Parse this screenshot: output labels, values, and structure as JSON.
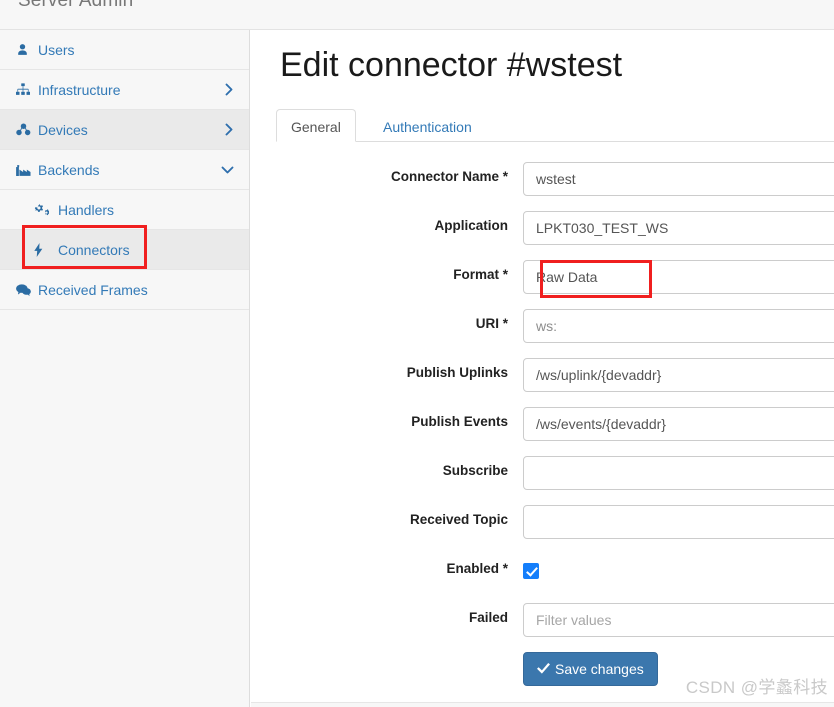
{
  "app": {
    "brand_title": "Server Admin"
  },
  "sidebar": {
    "items": [
      {
        "label": "Users",
        "icon": "user-icon",
        "chevron": "",
        "active": false,
        "sub": false
      },
      {
        "label": "Infrastructure",
        "icon": "sitemap-icon",
        "chevron": "chevron-right",
        "active": false,
        "sub": false
      },
      {
        "label": "Devices",
        "icon": "cubes-icon",
        "chevron": "chevron-right",
        "active": true,
        "sub": false
      },
      {
        "label": "Backends",
        "icon": "industry-icon",
        "chevron": "chevron-down",
        "active": false,
        "sub": false
      },
      {
        "label": "Handlers",
        "icon": "cogs-icon",
        "chevron": "",
        "active": false,
        "sub": true
      },
      {
        "label": "Connectors",
        "icon": "bolt-icon",
        "chevron": "",
        "active": true,
        "sub": true
      },
      {
        "label": "Received Frames",
        "icon": "comments-icon",
        "chevron": "",
        "active": false,
        "sub": false
      }
    ]
  },
  "main": {
    "page_title": "Edit connector #wstest",
    "tabs": [
      {
        "label": "General",
        "active": true
      },
      {
        "label": "Authentication",
        "active": false
      }
    ],
    "fields": [
      {
        "label": "Connector Name",
        "required": true,
        "value": "wstest",
        "placeholder": "",
        "muted": false
      },
      {
        "label": "Application",
        "required": false,
        "value": "LPKT030_TEST_WS",
        "placeholder": "",
        "muted": false
      },
      {
        "label": "Format",
        "required": true,
        "value": "Raw Data",
        "placeholder": "",
        "muted": false
      },
      {
        "label": "URI",
        "required": true,
        "value": "ws:",
        "placeholder": "",
        "muted": true
      },
      {
        "label": "Publish Uplinks",
        "required": false,
        "value": "/ws/uplink/{devaddr}",
        "placeholder": "",
        "muted": false
      },
      {
        "label": "Publish Events",
        "required": false,
        "value": "/ws/events/{devaddr}",
        "placeholder": "",
        "muted": false
      },
      {
        "label": "Subscribe",
        "required": false,
        "value": "",
        "placeholder": "",
        "muted": false
      },
      {
        "label": "Received Topic",
        "required": false,
        "value": "",
        "placeholder": "",
        "muted": false
      }
    ],
    "enabled_field": {
      "label": "Enabled",
      "required": true,
      "checked": true
    },
    "failed_field": {
      "label": "Failed",
      "required": false,
      "value": "",
      "placeholder": "Filter values"
    },
    "save_button": {
      "label": "Save changes",
      "icon": "check-icon"
    },
    "required_marker": "*"
  },
  "watermark": {
    "text": "CSDN @学蠡科技"
  },
  "colors": {
    "link": "#337ab7",
    "sidebar_bg": "#f7f7f7",
    "sidebar_active_bg": "#eaeaea",
    "primary_button": "#3b77ad",
    "checkbox_checked": "#147efb",
    "annotation_red": "#f01f1f",
    "watermark_gray": "#c9c9c9"
  }
}
